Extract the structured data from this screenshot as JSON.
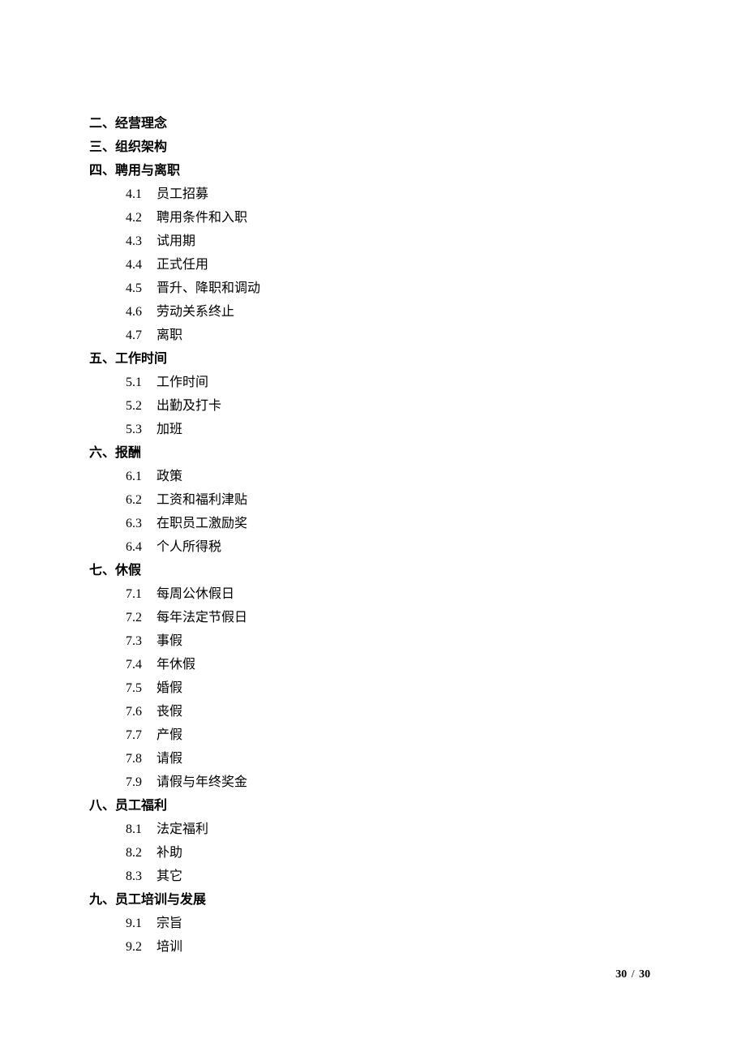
{
  "sections": [
    {
      "title": "二、经营理念",
      "items": []
    },
    {
      "title": "三、组织架构",
      "items": []
    },
    {
      "title": "四、聘用与离职",
      "items": [
        {
          "num": "4.1",
          "text": "员工招募"
        },
        {
          "num": "4.2",
          "text": "聘用条件和入职"
        },
        {
          "num": "4.3",
          "text": "试用期"
        },
        {
          "num": "4.4",
          "text": "正式任用"
        },
        {
          "num": "4.5",
          "text": "晋升、降职和调动"
        },
        {
          "num": "4.6",
          "text": "劳动关系终止"
        },
        {
          "num": "4.7",
          "text": "离职"
        }
      ]
    },
    {
      "title": "五、工作时间",
      "items": [
        {
          "num": "5.1",
          "text": "工作时间"
        },
        {
          "num": "5.2",
          "text": "出勤及打卡"
        },
        {
          "num": "5.3",
          "text": "加班"
        }
      ]
    },
    {
      "title": "六、报酬",
      "items": [
        {
          "num": "6.1",
          "text": "政策"
        },
        {
          "num": "6.2",
          "text": "工资和福利津贴"
        },
        {
          "num": "6.3",
          "text": "在职员工激励奖"
        },
        {
          "num": "6.4",
          "text": "个人所得税"
        }
      ]
    },
    {
      "title": "七、休假",
      "items": [
        {
          "num": "7.1",
          "text": "每周公休假日"
        },
        {
          "num": "7.2",
          "text": "每年法定节假日"
        },
        {
          "num": "7.3",
          "text": "事假"
        },
        {
          "num": "7.4",
          "text": "年休假"
        },
        {
          "num": "7.5",
          "text": "婚假"
        },
        {
          "num": "7.6",
          "text": "丧假"
        },
        {
          "num": "7.7",
          "text": "产假"
        },
        {
          "num": "7.8",
          "text": "请假"
        },
        {
          "num": "7.9",
          "text": "请假与年终奖金"
        }
      ]
    },
    {
      "title": "八、员工福利",
      "items": [
        {
          "num": "8.1",
          "text": "法定福利"
        },
        {
          "num": "8.2",
          "text": "补助"
        },
        {
          "num": "8.3",
          "text": "其它"
        }
      ]
    },
    {
      "title": "九、员工培训与发展",
      "items": [
        {
          "num": "9.1",
          "text": "宗旨"
        },
        {
          "num": "9.2",
          "text": "培训"
        }
      ]
    }
  ],
  "footer": {
    "current": "30",
    "total": "30"
  }
}
